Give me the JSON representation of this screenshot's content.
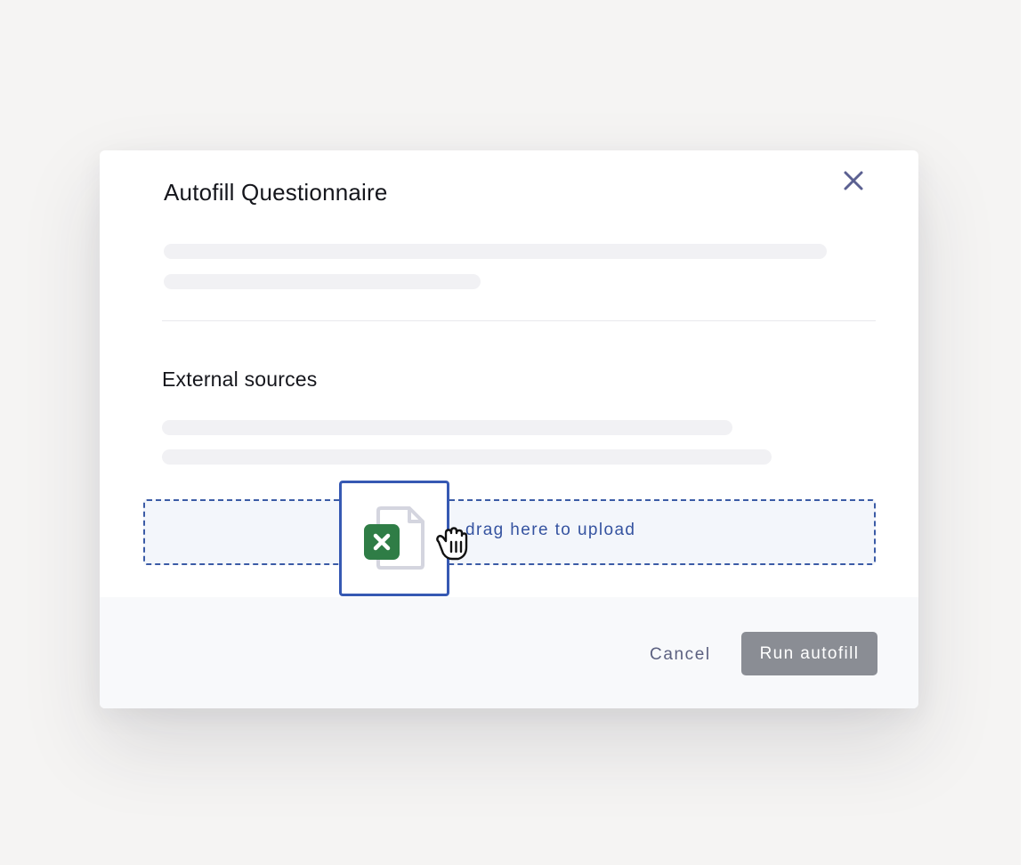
{
  "modal": {
    "title": "Autofill Questionnaire",
    "section_title": "External sources",
    "dropzone_text": "drag here to upload",
    "footer": {
      "cancel_label": "Cancel",
      "run_label": "Run autofill"
    }
  },
  "colors": {
    "accent": "#3659b3",
    "excel_green": "#2f7d46",
    "run_button_disabled": "#8a8d94",
    "close_icon": "#5b6091"
  },
  "icons": {
    "close": "close-icon",
    "file": "excel-file-icon",
    "cursor": "grab-hand-cursor-icon"
  }
}
